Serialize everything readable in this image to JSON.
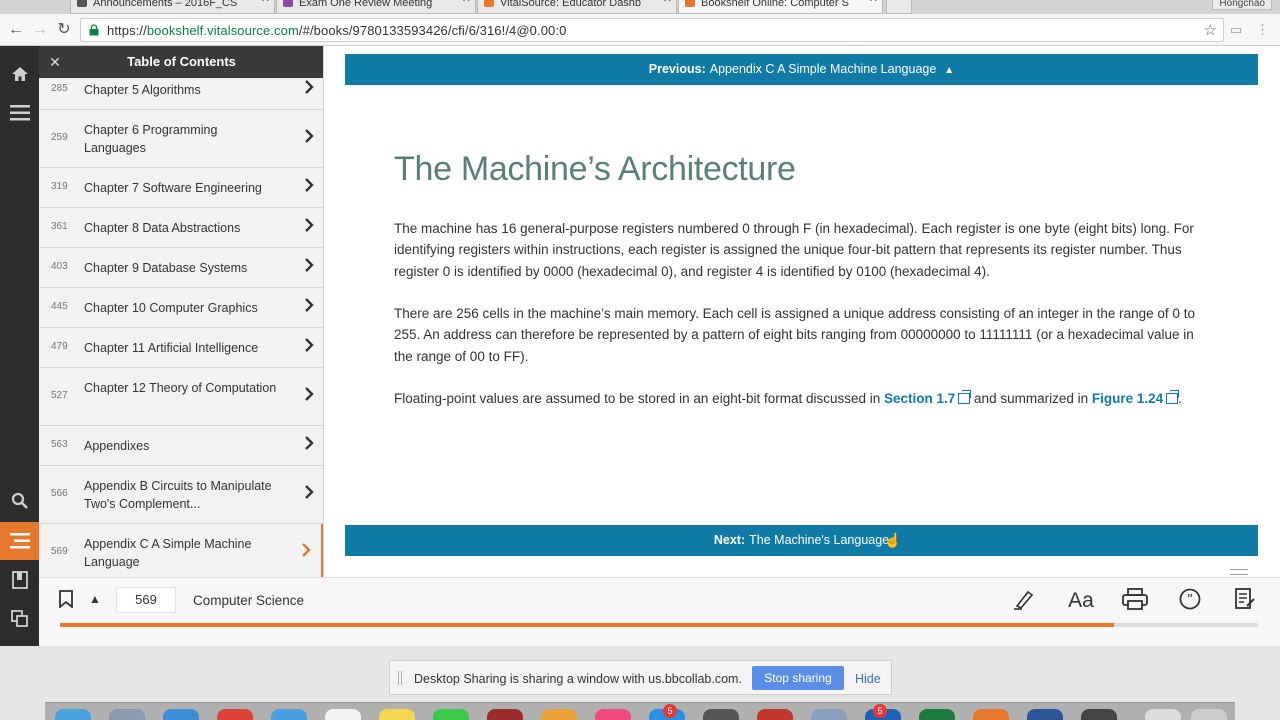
{
  "browser": {
    "tabs": [
      {
        "title": "Announcements – 2016F_CS",
        "icon_color": "#555555",
        "active": false
      },
      {
        "title": "Exam One Review Meeting",
        "icon_color": "#8e44ad",
        "active": false
      },
      {
        "title": "VitalSource: Educator Dashb",
        "icon_color": "#e8772e",
        "active": false
      },
      {
        "title": "Bookshelf Online: Computer S",
        "icon_color": "#e8772e",
        "active": true
      }
    ],
    "profile_label": "Hongchao",
    "url_prefix": "https://",
    "url_host": "bookshelf.vitalsource.com",
    "url_path": "/#/books/9780133593426/cfi/6/316!/4@0.00:0",
    "back_icon": "back-arrow-icon",
    "forward_icon": "forward-arrow-icon",
    "reload_icon": "reload-icon"
  },
  "rail": {
    "items": [
      "home-icon",
      "menu-icon",
      "search-icon",
      "toc-icon",
      "bookmark-page-icon",
      "copy-icon"
    ]
  },
  "toc": {
    "title": "Table of Contents",
    "close_label": "✕",
    "items": [
      {
        "page": "285",
        "label": "Chapter 5 Algorithms",
        "lines": 1
      },
      {
        "page": "259",
        "label": "Chapter 6 Programming Languages",
        "lines": 2
      },
      {
        "page": "319",
        "label": "Chapter 7 Software Engineering",
        "lines": 1
      },
      {
        "page": "361",
        "label": "Chapter 8 Data Abstractions",
        "lines": 1
      },
      {
        "page": "403",
        "label": "Chapter 9 Database Systems",
        "lines": 1
      },
      {
        "page": "445",
        "label": "Chapter 10 Computer Graphics",
        "lines": 1
      },
      {
        "page": "479",
        "label": "Chapter 11 Artificial Intelligence",
        "lines": 1
      },
      {
        "page": "527",
        "label": "Chapter 12 Theory of Computation",
        "lines": 2
      },
      {
        "page": "563",
        "label": "Appendixes",
        "lines": 1
      },
      {
        "page": "566",
        "label": "Appendix B Circuits to Manipulate Two's Complement...",
        "lines": 2
      },
      {
        "page": "569",
        "label": "Appendix C A Simple Machine Language",
        "lines": 2
      }
    ]
  },
  "reader": {
    "previous_prefix": "Previous:",
    "previous_label": "Appendix C A Simple Machine Language",
    "next_prefix": "Next:",
    "next_label": "The Machine's Language",
    "section_title": "The Machine’s Architecture",
    "para1": "The machine has 16 general-purpose registers numbered 0 through F (in hexadecimal). Each register is one byte (eight bits) long. For identifying registers within instructions, each register is assigned the unique four-bit pattern that represents its register number. Thus register 0 is identified by 0000 (hexadecimal 0), and register 4 is identified by 0100 (hexadecimal 4).",
    "para2": "There are 256 cells in the machine’s main memory. Each cell is assigned a unique address consisting of an integer in the range of 0 to 255. An address can therefore be represented by a pattern of eight bits ranging from 00000000 to 11111111 (or a hexadecimal value in the range of 00 to FF).",
    "para3_start": "Floating-point values are assumed to be stored in an eight-bit format discussed in ",
    "link1": "Section 1.7",
    "para3_mid": " and summarized in ",
    "link2": "Figure 1.24",
    "para3_end": "."
  },
  "bottombar": {
    "page_number": "569",
    "book_title": "Computer Science",
    "progress_percent": 88,
    "tools": [
      "highlighter-icon",
      "text-size-icon",
      "print-icon",
      "quote-icon",
      "notes-icon"
    ],
    "text_size_label": "Aa"
  },
  "share": {
    "message": "Desktop Sharing is sharing a window with us.bbcollab.com.",
    "stop_label": "Stop sharing",
    "hide_label": "Hide"
  },
  "colors": {
    "accent": "#e8772e",
    "nav_blue": "#107ba6",
    "title_teal": "#5a7e7a"
  }
}
